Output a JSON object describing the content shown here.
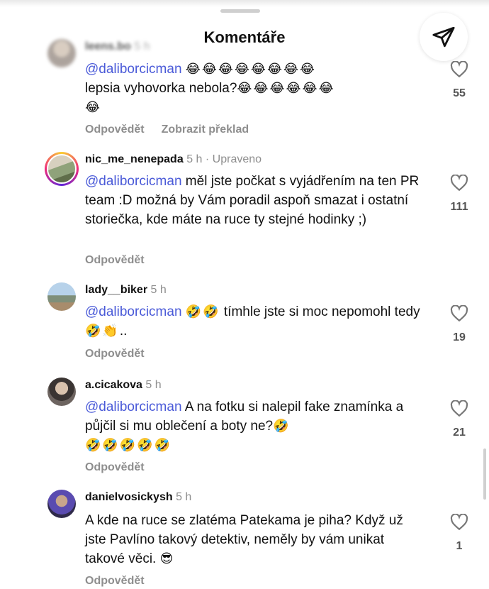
{
  "header": {
    "title": "Komentáře",
    "share_icon": "paper-plane-icon"
  },
  "comments": [
    {
      "username": "leens.bo",
      "time": "5 h",
      "mention": "@daliborcicman",
      "text_after_mention": " ",
      "emoji_after_mention": "😂😂😂😂😂😂😂😂",
      "text_line2": "lepsia vyhovorka nebola?",
      "emoji_line2": "😂😂😂😂😂😂",
      "emoji_line3": "😂",
      "reply_label": "Odpovědět",
      "translate_label": "Zobrazit překlad",
      "likes": "55"
    },
    {
      "username": "nic_me_nenepada",
      "time": "5 h",
      "edited": "· Upraveno",
      "mention": "@daliborcicman",
      "text": " měl jste počkat s vyjádřením na ten PR team :D možná by Vám poradil aspoň smazat i ostatní storiečka, kde máte na ruce ty stejné hodinky ;)",
      "reply_label": "Odpovědět",
      "likes": "111"
    },
    {
      "username": "lady__biker",
      "time": "5 h",
      "mention": "@daliborcicman",
      "emoji_a": "🤣🤣",
      "text_a": " tímhle jste si moc nepomohl tedy ",
      "emoji_b": "🤣👏",
      "text_b": "..",
      "reply_label": "Odpovědět",
      "likes": "19"
    },
    {
      "username": "a.cicakova",
      "time": "5 h",
      "mention": "@daliborcicman",
      "text": " A na fotku si nalepil fake znamínka a půjčil si mu oblečení a boty ne?",
      "emoji_a": "🤣",
      "emoji_b": "🤣🤣🤣🤣🤣",
      "reply_label": "Odpovědět",
      "likes": "21"
    },
    {
      "username": "danielvosickysh",
      "time": "5 h",
      "text": "A kde na ruce se zlatéma Patekama je piha? Když už jste Pavlíno takový detektiv, neměly by vám unikat takové věci. ",
      "emoji": "😎",
      "reply_label": "Odpovědět",
      "likes": "1"
    }
  ]
}
